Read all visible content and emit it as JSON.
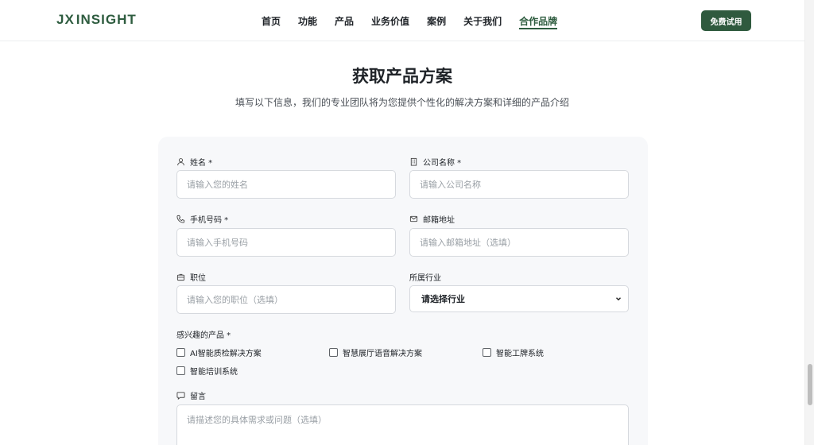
{
  "header": {
    "logo_text": "INSIGHT",
    "logo_prefix": "JX",
    "nav": [
      {
        "label": "首页"
      },
      {
        "label": "功能"
      },
      {
        "label": "产品"
      },
      {
        "label": "业务价值"
      },
      {
        "label": "案例"
      },
      {
        "label": "关于我们"
      },
      {
        "label": "合作品牌",
        "active": true
      }
    ],
    "cta_label": "免费试用"
  },
  "section": {
    "title": "获取产品方案",
    "subtitle": "填写以下信息，我们的专业团队将为您提供个性化的解决方案和详细的产品介绍"
  },
  "form": {
    "name": {
      "label": "姓名 *",
      "placeholder": "请输入您的姓名"
    },
    "company": {
      "label": "公司名称 *",
      "placeholder": "请输入公司名称"
    },
    "phone": {
      "label": "手机号码 *",
      "placeholder": "请输入手机号码"
    },
    "email": {
      "label": "邮箱地址",
      "placeholder": "请输入邮箱地址（选填）"
    },
    "position": {
      "label": "职位",
      "placeholder": "请输入您的职位（选填）"
    },
    "industry": {
      "label": "所属行业",
      "selected": "请选择行业"
    },
    "products": {
      "label": "感兴趣的产品 *",
      "options": [
        {
          "label": "AI智能质检解决方案",
          "checked": false
        },
        {
          "label": "智慧展厅语音解决方案",
          "checked": false
        },
        {
          "label": "智能工牌系统",
          "checked": false
        },
        {
          "label": "智能培训系统",
          "checked": false
        }
      ]
    },
    "message": {
      "label": "留言",
      "placeholder": "请描述您的具体需求或问题（选填）"
    }
  },
  "colors": {
    "brand": "#2e5c3f",
    "card_bg": "#f7f8fa",
    "border": "#d6d9de"
  }
}
